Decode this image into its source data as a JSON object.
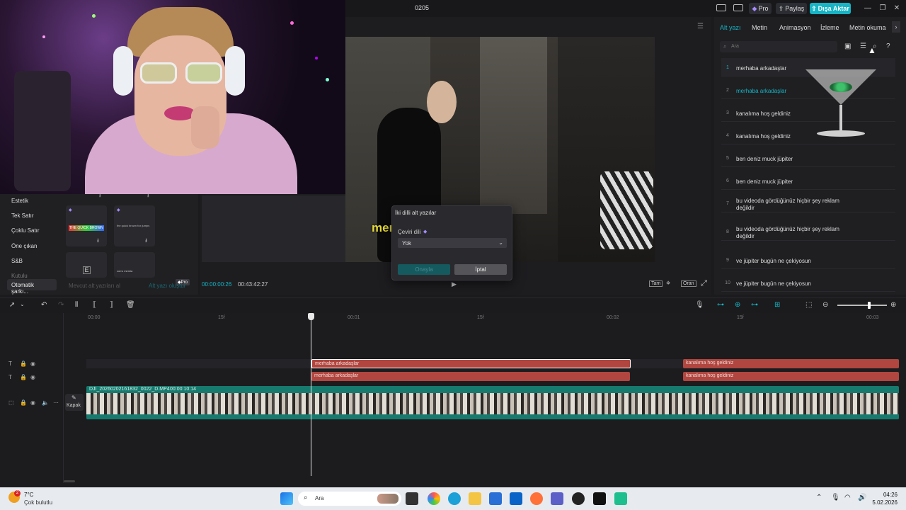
{
  "window": {
    "title": "0205"
  },
  "header": {
    "pro_label": "Pro",
    "share_label": "Paylaş",
    "export_label": "Dışa Aktar"
  },
  "left_panel": {
    "categories": [
      "Estetik",
      "Tek Satır",
      "Çoklu Satır",
      "Öne çıkan",
      "S&B",
      "Kutulu"
    ],
    "active_category": "Otomatik şarkı...",
    "thumbnails": [
      "THE QUICK BROWN",
      "the quick brown fox jumps",
      "",
      "zorro memia"
    ],
    "existing_subs": "Mevcut alt yazıları al",
    "generate": "Alt yazı oluştur"
  },
  "preview": {
    "current_time": "00:00:00:26",
    "total_time": "00:43:42:27",
    "overlay_text": "merhaba arkadaşlar",
    "full_label": "Tam",
    "ratio_label": "Oran"
  },
  "dialog": {
    "title": "İki dilli alt yazılar",
    "field_label": "Çeviri dili",
    "select_value": "Yok",
    "confirm_label": "Onayla",
    "cancel_label": "İptal"
  },
  "right_panel": {
    "tabs": [
      "Alt yazı",
      "Metin",
      "Animasyon",
      "İzleme",
      "Metin okuma"
    ],
    "search_placeholder": "Ara",
    "subtitles": [
      {
        "num": "1",
        "text": "merhaba arkadaşlar"
      },
      {
        "num": "2",
        "text": "merhaba arkadaşlar"
      },
      {
        "num": "3",
        "text": "kanalıma hoş geldiniz"
      },
      {
        "num": "4",
        "text": "kanalıma hoş geldiniz"
      },
      {
        "num": "5",
        "text": "ben deniz muck jüpiter"
      },
      {
        "num": "6",
        "text": "ben deniz muck jüpiter"
      },
      {
        "num": "7",
        "text": "bu videoda gördüğünüz hiçbir şey reklam değildir"
      },
      {
        "num": "8",
        "text": "bu videoda gördüğünüz hiçbir şey reklam değildir"
      },
      {
        "num": "9",
        "text": "ve jüpiter bugün ne çekiyosun"
      },
      {
        "num": "10",
        "text": "ve jüpiter bugün ne çekiyosun"
      }
    ]
  },
  "timeline": {
    "ruler": [
      "00:00",
      "15f",
      "00:01",
      "15f",
      "00:02",
      "15f",
      "00:03"
    ],
    "track1": [
      {
        "label": "merhaba arkadaşlar"
      },
      {
        "label": "kanalıma hoş geldiniz"
      }
    ],
    "track2": [
      {
        "label": "merhaba arkadaşlar"
      },
      {
        "label": "kanalıma hoş geldiniz"
      }
    ],
    "video_clip": {
      "name": "DJI_20260202161832_0022_D.MP4",
      "duration": "00:00:10:14"
    },
    "cover_label": "Kapak"
  },
  "taskbar": {
    "weather_temp": "7°C",
    "weather_desc": "Çok bulutlu",
    "weather_badge": "2",
    "search_placeholder": "Ara",
    "time": "04:26",
    "date": "5.02.2026"
  },
  "colors": {
    "accent": "#16b4c4",
    "clip_red": "#b0463f",
    "video_track": "#167a6e"
  }
}
